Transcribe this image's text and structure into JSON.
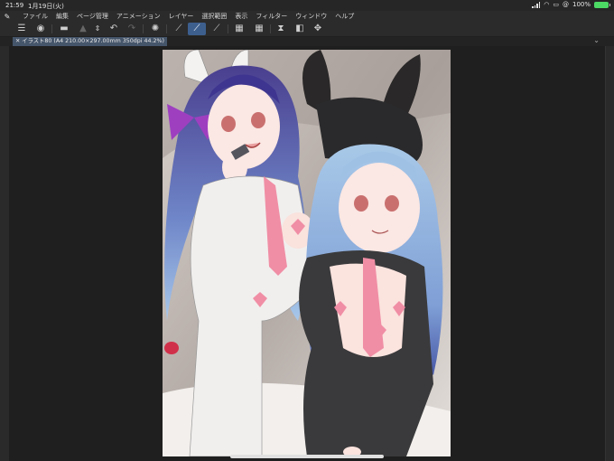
{
  "status": {
    "time": "21:59",
    "date": "1月19日(火)",
    "battery": "100%"
  },
  "menu": [
    "ファイル",
    "編集",
    "ページ管理",
    "アニメーション",
    "レイヤー",
    "選択範囲",
    "表示",
    "フィルター",
    "ウィンドウ",
    "ヘルプ"
  ],
  "document_tab": {
    "close": "✕",
    "label": "イラスト80 (A4 210.00×297.00mm 350dpi 44.2%)"
  },
  "toolbar_icons": [
    "menu-icon",
    "app-icon",
    "open-folder-icon",
    "save-icon",
    "undo-icon",
    "redo-icon",
    "gear-icon",
    "pen-icon",
    "brush-icon",
    "eraser-icon",
    "grid-icon",
    "grid-dense-icon",
    "hourglass-icon",
    "flip-icon",
    "transform-icon"
  ]
}
